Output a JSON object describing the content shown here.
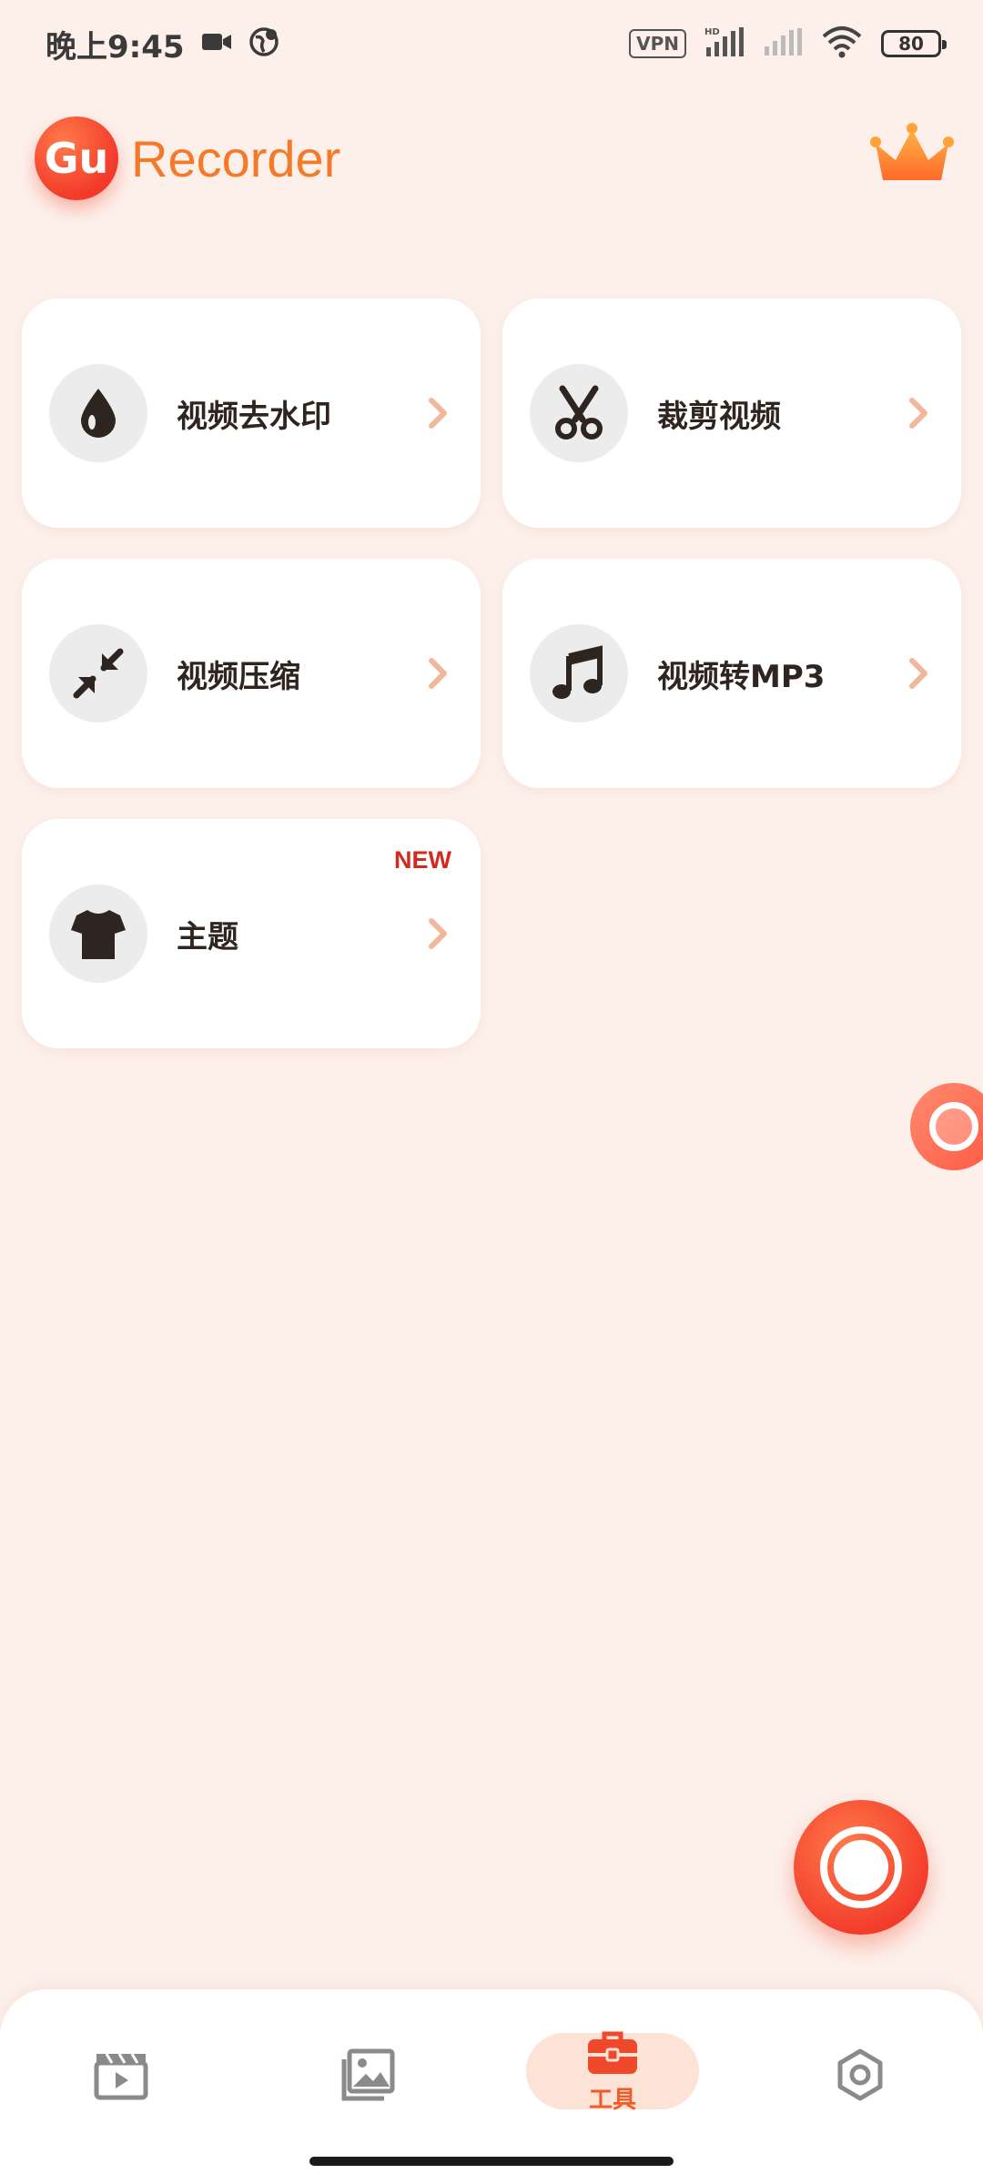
{
  "status_bar": {
    "time": "晚上9:45",
    "vpn": "VPN",
    "hd": "HD",
    "battery": "80"
  },
  "header": {
    "logo_text": "Gu",
    "app_name": "Recorder",
    "premium_icon": "crown-icon"
  },
  "tools": [
    {
      "label": "视频去水印",
      "icon": "water-drop-icon"
    },
    {
      "label": "裁剪视频",
      "icon": "scissors-icon"
    },
    {
      "label": "视频压缩",
      "icon": "compress-icon"
    },
    {
      "label": "视频转MP3",
      "icon": "music-note-icon"
    },
    {
      "label": "主题",
      "icon": "tshirt-icon",
      "badge": "NEW"
    }
  ],
  "bottom_nav": {
    "items": [
      {
        "icon": "video-clapper-icon",
        "label": ""
      },
      {
        "icon": "gallery-icon",
        "label": ""
      },
      {
        "icon": "toolbox-icon",
        "label": "工具",
        "active": true
      },
      {
        "icon": "settings-icon",
        "label": ""
      }
    ]
  },
  "colors": {
    "background": "#fdf0eb",
    "accent": "#f25a2a",
    "brand_text": "#f47a2a",
    "badge_red": "#d22a1e"
  }
}
